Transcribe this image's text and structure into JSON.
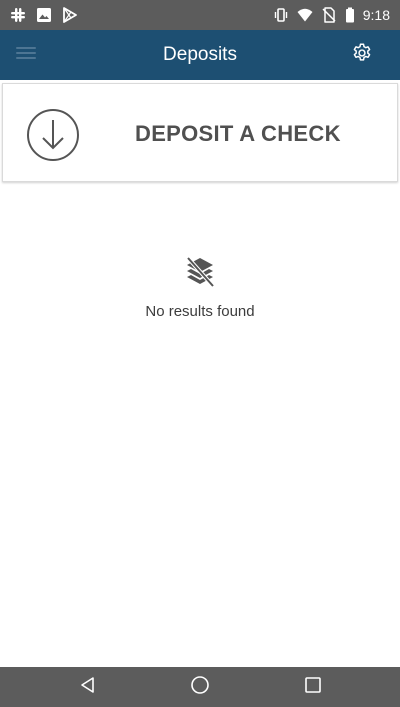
{
  "status_bar": {
    "time": "9:18",
    "left_icons": [
      "slack-icon",
      "image-icon",
      "play-store-icon"
    ],
    "right_icons": [
      "vibrate-icon",
      "wifi-icon",
      "no-sim-icon",
      "battery-icon"
    ]
  },
  "app_bar": {
    "title": "Deposits",
    "menu_icon": "hamburger-menu-icon",
    "settings_icon": "gear-icon",
    "background": "#1d4f72"
  },
  "deposit_card": {
    "label": "DEPOSIT A CHECK",
    "icon": "download-circle-icon"
  },
  "empty_state": {
    "icon": "no-results-icon",
    "message": "No results found"
  },
  "nav_bar": {
    "buttons": [
      "back-icon",
      "home-icon",
      "recents-icon"
    ]
  }
}
